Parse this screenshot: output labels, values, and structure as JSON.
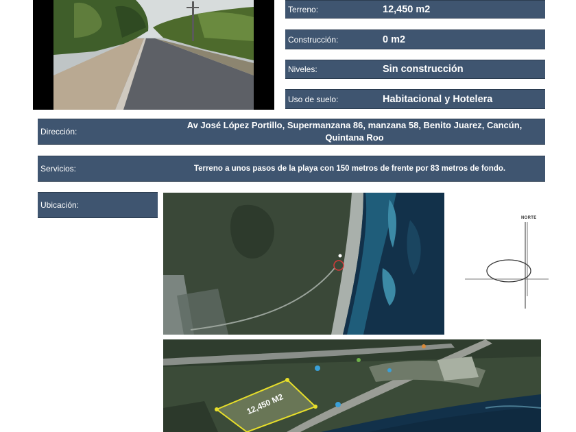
{
  "summary": [
    {
      "label": "Terreno:",
      "value": "12,450 m2"
    },
    {
      "label": "Construcción:",
      "value": "0 m2"
    },
    {
      "label": "Niveles:",
      "value": "Sin construcción"
    },
    {
      "label": "Uso de suelo:",
      "value": "Habitacional y Hotelera"
    }
  ],
  "direccion": {
    "label": "Dirección:",
    "value": "Av José López Portillo, Supermanzana 86, manzana 58, Benito Juarez, Cancún, Quintana Roo"
  },
  "servicios": {
    "label": "Servicios:",
    "value": "Terreno a unos pasos de la playa con 150 metros de frente por 83 metros de fondo."
  },
  "ubicacion": {
    "label": "Ubicación:"
  },
  "compass": {
    "north_label": "NORTE"
  },
  "lot_area_label": "12,450 M2",
  "colors": {
    "bar": "#3f5570",
    "land": "#3c4a3a",
    "sea": "#12314a",
    "lot_outline": "#e8df2a",
    "pin": "#d43a3a"
  }
}
